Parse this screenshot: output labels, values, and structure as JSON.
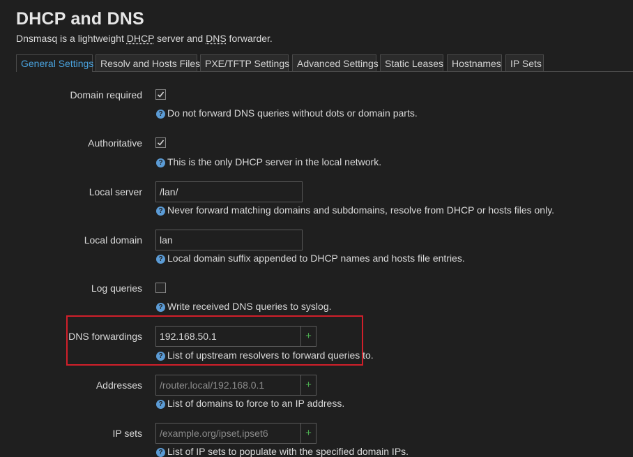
{
  "header": {
    "title": "DHCP and DNS",
    "subtitle_prefix": "Dnsmasq is a lightweight ",
    "subtitle_abbr1": "DHCP",
    "subtitle_mid": " server and ",
    "subtitle_abbr2": "DNS",
    "subtitle_suffix": " forwarder."
  },
  "tabs": [
    {
      "label": "General Settings",
      "active": true
    },
    {
      "label": "Resolv and Hosts Files"
    },
    {
      "label": "PXE/TFTP Settings"
    },
    {
      "label": "Advanced Settings"
    },
    {
      "label": "Static Leases"
    },
    {
      "label": "Hostnames"
    },
    {
      "label": "IP Sets"
    }
  ],
  "fields": {
    "domain_required": {
      "label": "Domain required",
      "checked": true,
      "help": "Do not forward DNS queries without dots or domain parts."
    },
    "authoritative": {
      "label": "Authoritative",
      "checked": true,
      "help": "This is the only DHCP server in the local network."
    },
    "local_server": {
      "label": "Local server",
      "value": "/lan/",
      "help": "Never forward matching domains and subdomains, resolve from DHCP or hosts files only."
    },
    "local_domain": {
      "label": "Local domain",
      "value": "lan",
      "help": "Local domain suffix appended to DHCP names and hosts file entries."
    },
    "log_queries": {
      "label": "Log queries",
      "checked": false,
      "help": "Write received DNS queries to syslog."
    },
    "dns_forwardings": {
      "label": "DNS forwardings",
      "value": "192.168.50.1",
      "add": "+",
      "help": "List of upstream resolvers to forward queries to."
    },
    "addresses": {
      "label": "Addresses",
      "placeholder": "/router.local/192.168.0.1",
      "add": "+",
      "help": "List of domains to force to an IP address."
    },
    "ip_sets": {
      "label": "IP sets",
      "placeholder": "/example.org/ipset,ipset6",
      "add": "+",
      "help": "List of IP sets to populate with the specified domain IPs."
    }
  },
  "icons": {
    "help": "question-circle-icon",
    "check": "check-icon",
    "add": "plus-icon"
  },
  "colors": {
    "accent": "#4aa3df",
    "highlight": "#d11f2a",
    "add": "#4caf50"
  }
}
